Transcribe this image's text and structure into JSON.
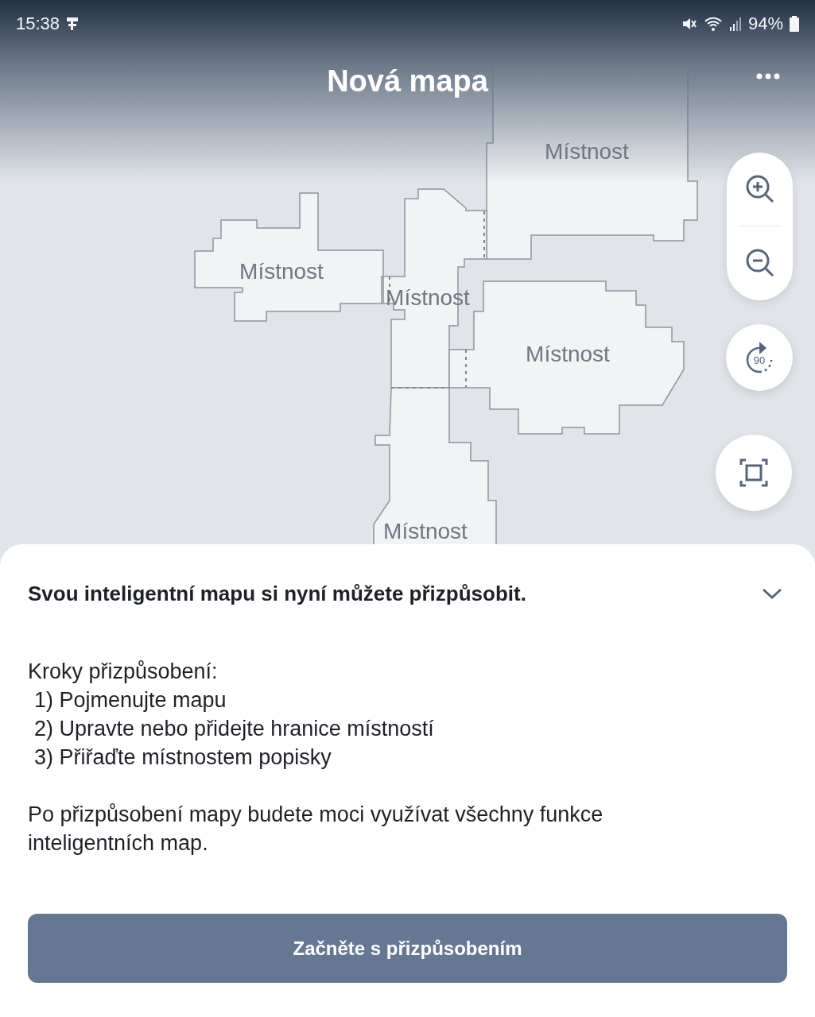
{
  "status_bar": {
    "time": "15:38",
    "battery": "94%"
  },
  "header": {
    "title": "Nová mapa"
  },
  "map": {
    "rooms": [
      {
        "label": "Místnost"
      },
      {
        "label": "Místnost"
      },
      {
        "label": "Místnost"
      },
      {
        "label": "Místnost"
      },
      {
        "label": "Místnost"
      }
    ],
    "rotate_label": "90"
  },
  "sheet": {
    "title": "Svou inteligentní mapu si nyní můžete přizpůsobit.",
    "steps_heading": "Kroky přizpůsobení:",
    "steps": [
      "1) Pojmenujte mapu",
      "2) Upravte nebo přidejte hranice místností",
      "3) Přiřaďte místnostem popisky"
    ],
    "note": "Po přizpůsobení mapy budete moci využívat všechny funkce inteligentních map.",
    "button": "Začněte s přizpůsobením"
  }
}
